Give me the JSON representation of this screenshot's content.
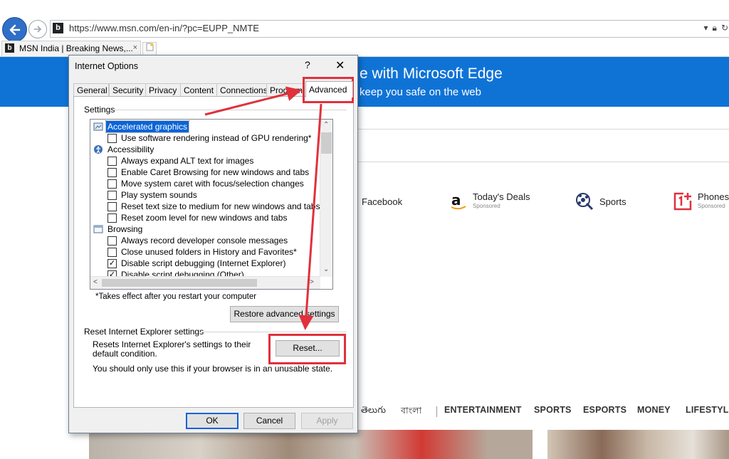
{
  "browser": {
    "url": "https://www.msn.com/en-in/?pc=EUPP_NMTE",
    "tab_title": "MSN India | Breaking News,...",
    "tab_close": "×",
    "favicon_letter": "b"
  },
  "page": {
    "banner_heading": "e with Microsoft Edge",
    "banner_sub": "keep you safe on the web",
    "quicklinks": [
      {
        "label": "Facebook",
        "sponsored": ""
      },
      {
        "label": "Today's Deals",
        "sponsored": "Sponsored"
      },
      {
        "label": "Sports",
        "sponsored": ""
      },
      {
        "label": "Phones",
        "sponsored": "Sponsored"
      }
    ],
    "menu": [
      "తెలుగు",
      "বাংলা",
      "ENTERTAINMENT",
      "SPORTS",
      "ESPORTS",
      "MONEY",
      "LIFESTYLE"
    ]
  },
  "dialog": {
    "title": "Internet Options",
    "help": "?",
    "close": "✕",
    "tabs": [
      "General",
      "Security",
      "Privacy",
      "Content",
      "Connections",
      "Programs",
      "Advanced"
    ],
    "active_tab": "Advanced",
    "settings_label": "Settings",
    "settings": [
      {
        "type": "category",
        "icon": "graphics-icon",
        "label": "Accelerated graphics",
        "selected": true
      },
      {
        "type": "option",
        "label": "Use software rendering instead of GPU rendering*",
        "checked": false
      },
      {
        "type": "category",
        "icon": "accessibility-icon",
        "label": "Accessibility",
        "selected": false
      },
      {
        "type": "option",
        "label": "Always expand ALT text for images",
        "checked": false
      },
      {
        "type": "option",
        "label": "Enable Caret Browsing for new windows and tabs",
        "checked": false
      },
      {
        "type": "option",
        "label": "Move system caret with focus/selection changes",
        "checked": false
      },
      {
        "type": "option",
        "label": "Play system sounds",
        "checked": false
      },
      {
        "type": "option",
        "label": "Reset text size to medium for new windows and tabs",
        "checked": false
      },
      {
        "type": "option",
        "label": "Reset zoom level for new windows and tabs",
        "checked": false
      },
      {
        "type": "category",
        "icon": "browsing-icon",
        "label": "Browsing",
        "selected": false
      },
      {
        "type": "option",
        "label": "Always record developer console messages",
        "checked": false
      },
      {
        "type": "option",
        "label": "Close unused folders in History and Favorites*",
        "checked": false
      },
      {
        "type": "option",
        "label": "Disable script debugging (Internet Explorer)",
        "checked": true
      },
      {
        "type": "option",
        "label": "Disable script debugging (Other)",
        "checked": true
      }
    ],
    "restart_note": "*Takes effect after you restart your computer",
    "restore_button": "Restore advanced settings",
    "reset_group_label": "Reset Internet Explorer settings",
    "reset_desc": "Resets Internet Explorer's settings to their default condition.",
    "reset_button": "Reset...",
    "warning": "You should only use this if your browser is in an unusable state.",
    "ok": "OK",
    "cancel": "Cancel",
    "apply": "Apply"
  },
  "colors": {
    "banner": "#0f73d6",
    "highlight": "#e0313c",
    "selection": "#0a64d7"
  }
}
